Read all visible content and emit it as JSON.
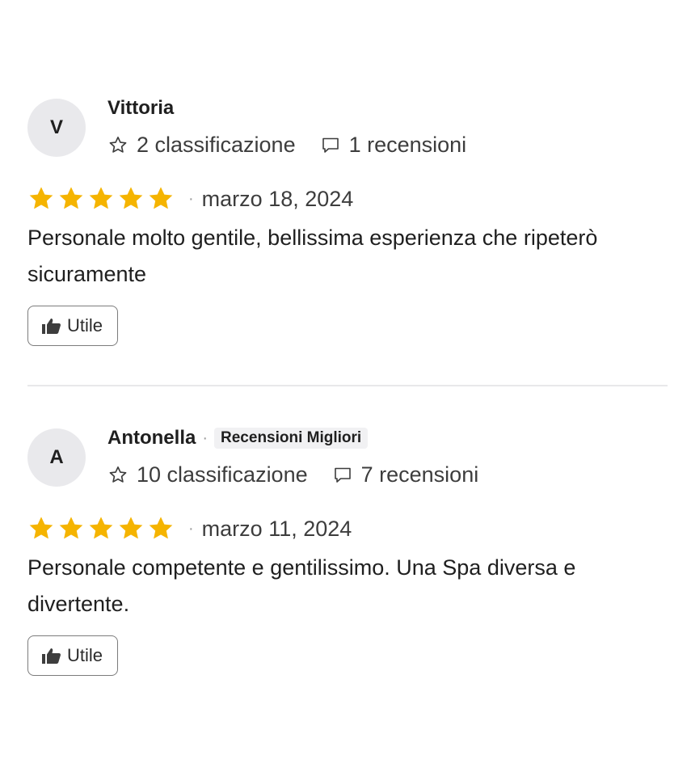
{
  "reviews": [
    {
      "avatar_letter": "V",
      "name": "Vittoria",
      "badge": "",
      "ratings_count": "2 classificazione",
      "reviews_count": "1 recensioni",
      "stars": 5,
      "date": "marzo 18, 2024",
      "text": "Personale molto gentile, bellissima esperienza che ripeterò sicuramente",
      "helpful_label": "Utile"
    },
    {
      "avatar_letter": "A",
      "name": "Antonella",
      "badge": "Recensioni Migliori",
      "ratings_count": "10 classificazione",
      "reviews_count": "7 recensioni",
      "stars": 5,
      "date": "marzo 11, 2024",
      "text": "Personale competente e gentilissimo. Una Spa diversa e divertente.",
      "helpful_label": "Utile"
    }
  ],
  "colors": {
    "star": "#f5b400",
    "avatar_bg": "#e9e9ec",
    "divider": "#e8e8ea"
  },
  "icons": {
    "rating": "star-outline-icon",
    "reviews": "comment-icon",
    "helpful": "thumbs-up-icon"
  }
}
